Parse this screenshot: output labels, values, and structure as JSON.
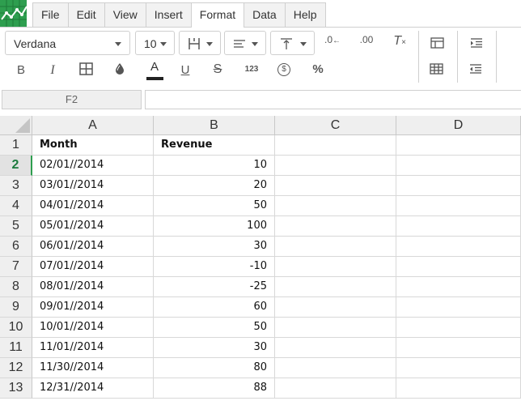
{
  "app": {
    "logo_icon": "spreadsheet-logo-icon",
    "accent": "#2e9e4f"
  },
  "menu": {
    "items": [
      {
        "label": "File"
      },
      {
        "label": "Edit"
      },
      {
        "label": "View"
      },
      {
        "label": "Insert"
      },
      {
        "label": "Format",
        "active": true
      },
      {
        "label": "Data"
      },
      {
        "label": "Help"
      }
    ]
  },
  "toolbar": {
    "font_family": "Verdana",
    "font_size": "10",
    "icons": {
      "borders": "borders-icon",
      "h_align": "align-left-icon",
      "v_align": "align-top-icon",
      "dec_decimals": "decrease-decimals-icon",
      "inc_decimals": "increase-decimals-icon",
      "clear_format": "clear-format-icon",
      "bold": "bold-icon",
      "italic": "italic-icon",
      "merge": "merge-cells-icon",
      "fill": "fill-color-icon",
      "text_color": "text-color-icon",
      "underline": "underline-icon",
      "strike": "strikethrough-icon",
      "number_format": "number-format-icon",
      "currency": "currency-icon",
      "percent": "percent-icon",
      "table": "table-icon",
      "grid": "grid-icon",
      "indent": "indent-icon",
      "outdent": "outdent-icon"
    },
    "labels": {
      "bold": "B",
      "italic": "I",
      "text_color": "A",
      "underline": "U",
      "strike": "S",
      "number_format": "123",
      "currency": "$",
      "percent": "%"
    },
    "text_color_swatch": "#222222"
  },
  "formula_bar": {
    "name_box": "F2",
    "formula": ""
  },
  "grid": {
    "columns": [
      "A",
      "B",
      "C",
      "D"
    ],
    "selected_row": 2,
    "rows": [
      {
        "n": "1",
        "a": "Month",
        "b": "Revenue"
      },
      {
        "n": "2",
        "a": "02/01//2014",
        "b": "10"
      },
      {
        "n": "3",
        "a": "03/01//2014",
        "b": "20"
      },
      {
        "n": "4",
        "a": "04/01//2014",
        "b": "50"
      },
      {
        "n": "5",
        "a": "05/01//2014",
        "b": "100"
      },
      {
        "n": "6",
        "a": "06/01//2014",
        "b": "30"
      },
      {
        "n": "7",
        "a": "07/01//2014",
        "b": "-10"
      },
      {
        "n": "8",
        "a": "08/01//2014",
        "b": "-25"
      },
      {
        "n": "9",
        "a": "09/01//2014",
        "b": "60"
      },
      {
        "n": "10",
        "a": "10/01//2014",
        "b": "50"
      },
      {
        "n": "11",
        "a": "11/01//2014",
        "b": "30"
      },
      {
        "n": "12",
        "a": "11/30//2014",
        "b": "80"
      },
      {
        "n": "13",
        "a": "12/31//2014",
        "b": "88"
      }
    ]
  }
}
